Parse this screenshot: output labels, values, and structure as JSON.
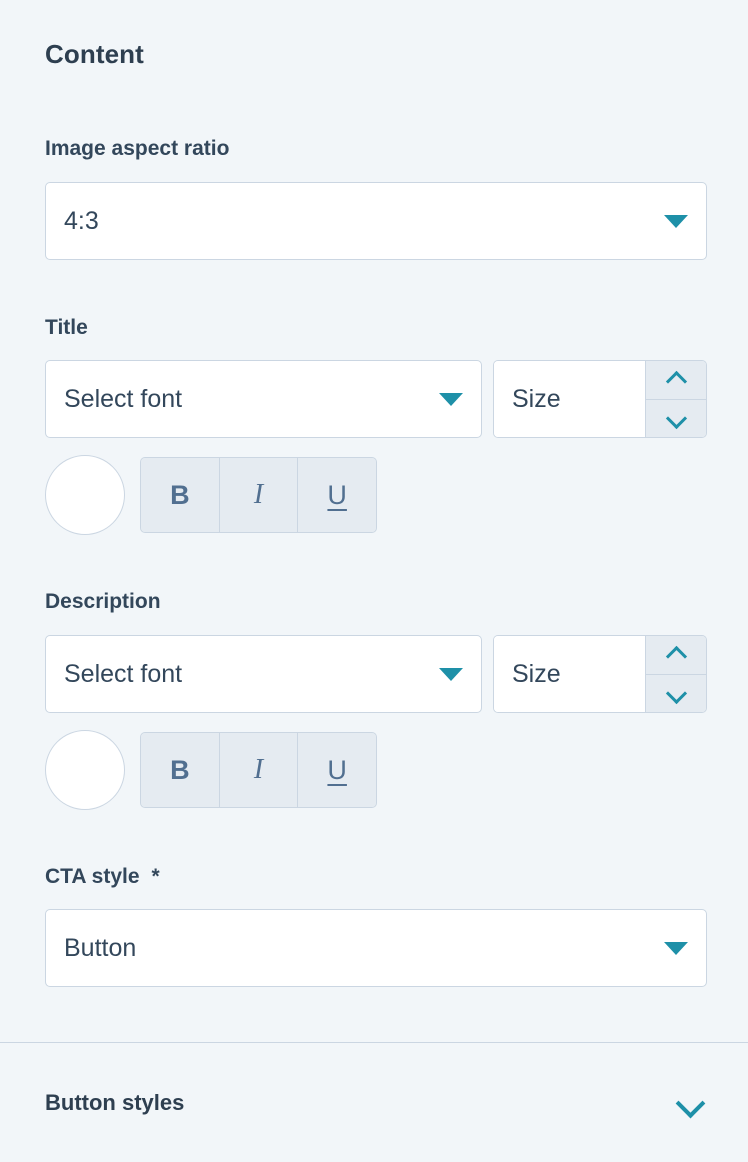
{
  "panel": {
    "section_title": "Content"
  },
  "fields": {
    "aspect_ratio": {
      "label": "Image aspect ratio",
      "value": "4:3",
      "caret_icon": "caret-down-icon"
    },
    "title": {
      "label": "Title",
      "font_placeholder": "Select font",
      "size_placeholder": "Size",
      "bold_label": "B",
      "italic_label": "I",
      "underline_label": "U",
      "color_swatch_value": "#ffffff"
    },
    "description": {
      "label": "Description",
      "font_placeholder": "Select font",
      "size_placeholder": "Size",
      "bold_label": "B",
      "italic_label": "I",
      "underline_label": "U",
      "color_swatch_value": "#ffffff"
    },
    "cta_style": {
      "label": "CTA style",
      "required_marker": "*",
      "value": "Button"
    }
  },
  "accordion": {
    "button_styles": {
      "title": "Button styles",
      "chevron_icon": "chevron-down-icon",
      "expanded": false
    }
  },
  "colors": {
    "background": "#f2f6f9",
    "text": "#33475b",
    "accent_teal": "#1e90a8",
    "border": "#cbd6e2",
    "control_fill": "#e5ebf1",
    "glyph": "#516f90"
  }
}
